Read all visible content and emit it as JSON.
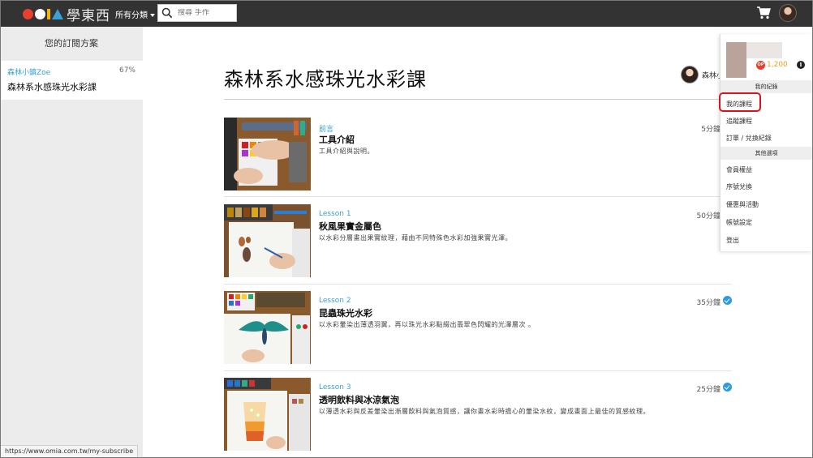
{
  "header": {
    "logo_text": "學東西",
    "logo_colors": [
      "#e8402c",
      "#ffffff",
      "#f2b705",
      "#3aa0d6"
    ],
    "categories_label": "所有分類",
    "search": {
      "placeholder": "搜尋 手作"
    },
    "cart_icon": "cart-icon",
    "avatar_icon": "user-avatar"
  },
  "sidebar": {
    "title": "您的訂閱方案",
    "subscriptions": [
      {
        "author": "森林小鎮Zoe",
        "progress": "67%",
        "course": "森林系水感珠光水彩課"
      }
    ]
  },
  "main": {
    "course_title": "森林系水感珠光水彩課",
    "author_name": "森林小",
    "lessons": [
      {
        "tag": "前言",
        "name": "工具介紹",
        "desc": "工具介紹與說明。",
        "duration": "5分鐘",
        "completed": true
      },
      {
        "tag": "Lesson 1",
        "name": "秋風果實金屬色",
        "desc": "以水彩分層畫出果實紋理，藉由不同特殊色水彩加強果實光澤。",
        "duration": "50分鐘",
        "completed": true
      },
      {
        "tag": "Lesson 2",
        "name": "昆蟲珠光水彩",
        "desc": "以水彩暈染出薄透羽翼，再以珠光水彩點綴出翡翠色閃耀的光澤層次 。",
        "duration": "35分鐘",
        "completed": true
      },
      {
        "tag": "Lesson 3",
        "name": "透明飲料與冰涼氣泡",
        "desc": "以薄透水彩與反差暈染出漸層飲料與氣泡質感，讓你畫水彩時擔心的暈染水紋，變成畫面上最佳的質感紋理。",
        "duration": "25分鐘",
        "completed": true
      }
    ]
  },
  "dropdown": {
    "op_label": "OP",
    "op_value": "1,200",
    "section_records": "我的紀錄",
    "items_records": [
      "我的課程",
      "追蹤課程",
      "訂單 / 兌換紀錄"
    ],
    "section_other": "其他選項",
    "items_other": [
      "會員權益",
      "序號兌換",
      "優惠與活動",
      "帳號設定",
      "登出"
    ],
    "highlighted_item": "我的課程",
    "highlight_color": "#e0101c"
  },
  "statusbar": {
    "url": "https://www.omia.com.tw/my-subscribe"
  }
}
